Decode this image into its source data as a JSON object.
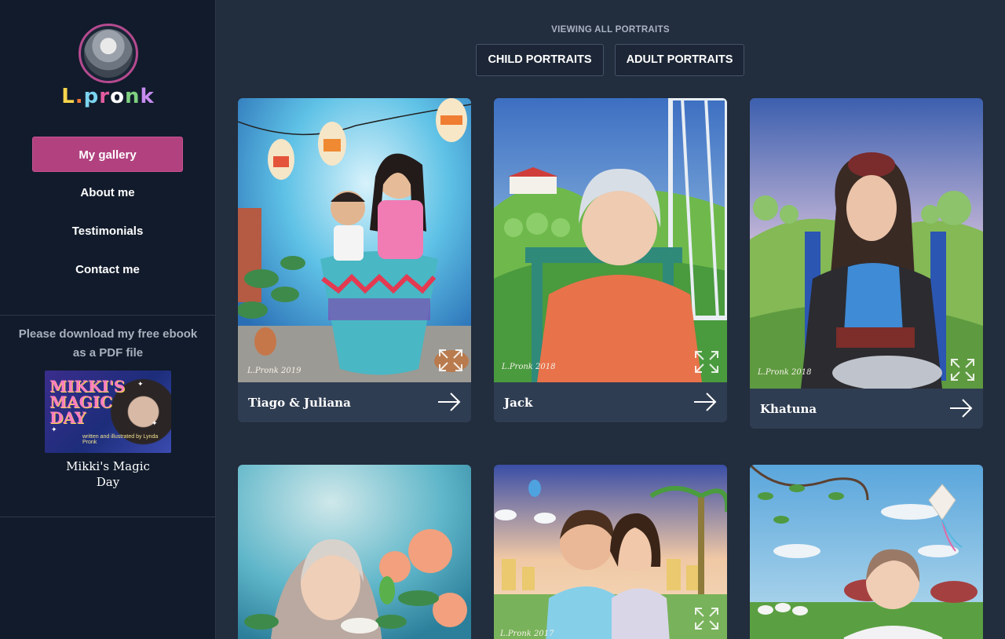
{
  "sidebar": {
    "logo_text": "L.pronk",
    "nav": [
      {
        "label": "My gallery"
      },
      {
        "label": "About me"
      },
      {
        "label": "Testimonials"
      },
      {
        "label": "Contact me"
      }
    ],
    "ebook": {
      "prompt_line1": "Please download my free ebook",
      "prompt_line2": "as a PDF file",
      "cover_title": "MIKKI'S MAGIC DAY",
      "cover_subtitle": "written and illustrated by Lynda Pronk",
      "title_line1": "Mikki's Magic",
      "title_line2": "Day"
    }
  },
  "main": {
    "view_label": "VIEWING ALL PORTRAITS",
    "filters": [
      {
        "label": "CHILD PORTRAITS"
      },
      {
        "label": "ADULT PORTRAITS"
      }
    ],
    "cards": [
      {
        "name": "Tiago & Juliana",
        "signature": "L.Pronk 2019"
      },
      {
        "name": "Jack",
        "signature": "L.Pronk 2018"
      },
      {
        "name": "Khatuna",
        "signature": "L.Pronk 2018"
      },
      {
        "name": ""
      },
      {
        "name": "",
        "signature": "L.Pronk 2017"
      },
      {
        "name": ""
      }
    ]
  },
  "colors": {
    "sidebar_bg": "#111b2b",
    "main_bg": "#222d3d",
    "accent": "#b1417f",
    "card_bg": "#2f3d52"
  }
}
